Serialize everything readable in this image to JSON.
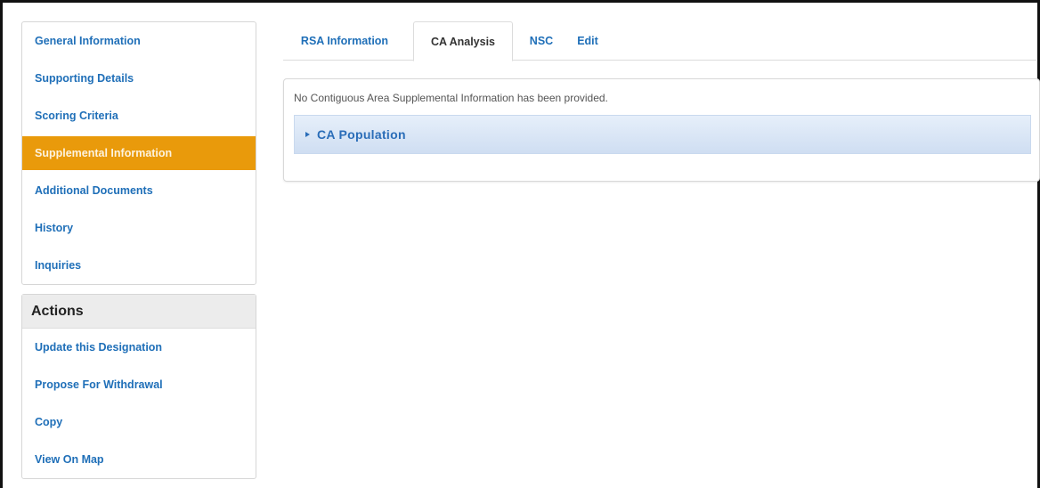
{
  "sidebar": {
    "items": [
      {
        "label": "General Information"
      },
      {
        "label": "Supporting Details"
      },
      {
        "label": "Scoring Criteria"
      },
      {
        "label": "Supplemental Information",
        "active": true
      },
      {
        "label": "Additional Documents"
      },
      {
        "label": "History"
      },
      {
        "label": "Inquiries"
      }
    ],
    "accent_color": "#e99a0b"
  },
  "actions": {
    "title": "Actions",
    "items": [
      {
        "label": "Update this Designation"
      },
      {
        "label": "Propose For Withdrawal"
      },
      {
        "label": "Copy"
      },
      {
        "label": "View On Map"
      }
    ]
  },
  "tabs": [
    {
      "label": "RSA Information"
    },
    {
      "label": "CA Analysis",
      "active": true
    },
    {
      "label": "NSC"
    },
    {
      "label": "Edit"
    }
  ],
  "content": {
    "notice": "No Contiguous Area Supplemental Information has been provided.",
    "accordion": {
      "label": "CA Population",
      "icon": "caret-right-icon",
      "expanded": false
    }
  },
  "colors": {
    "link": "#1f6fb8",
    "accordion_bg": "#dbe7f6"
  }
}
